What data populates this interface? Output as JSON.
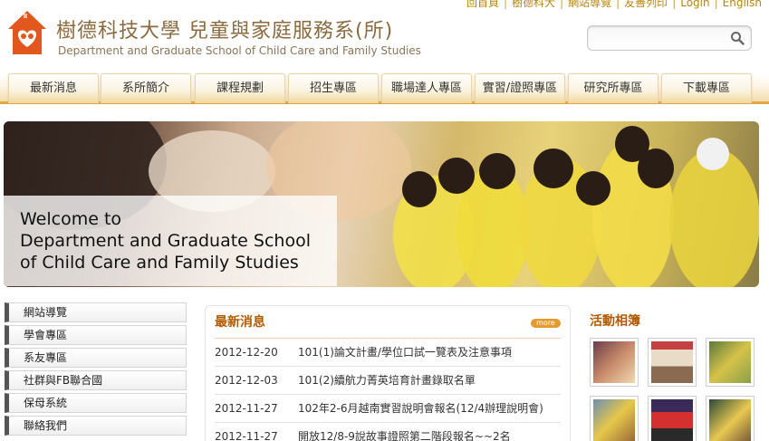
{
  "top_links": [
    "回首頁",
    "樹德科大",
    "網站導覽",
    "友善列印",
    "Login",
    "English"
  ],
  "header": {
    "title_zh": "樹德科技大學 兒童與家庭服務系(所)",
    "title_en": "Department and Graduate School of Child Care and Family Studies"
  },
  "search": {
    "placeholder": ""
  },
  "nav": [
    "最新消息",
    "系所簡介",
    "課程規劃",
    "招生專區",
    "職場達人專區",
    "實習/證照專區",
    "研究所專區",
    "下載專區"
  ],
  "banner": {
    "line1": "Welcome to",
    "line2": "Department and Graduate School",
    "line3": "of Child Care and Family Studies"
  },
  "left_menu": [
    "網站導覽",
    "學會專區",
    "系友專區",
    "社群與FB聯合國",
    "保母系統",
    "聯絡我們"
  ],
  "news": {
    "title": "最新消息",
    "more": "more",
    "items": [
      {
        "date": "2012-12-20",
        "text": "101(1)論文計畫/學位口試一覽表及注意事項"
      },
      {
        "date": "2012-12-03",
        "text": "101(2)續航力菁英培育計畫錄取名單"
      },
      {
        "date": "2012-11-27",
        "text": "102年2-6月越南實習說明會報名(12/4辦理說明會)"
      },
      {
        "date": "2012-11-27",
        "text": "開放12/8-9說故事證照第二階段報名~~2名"
      }
    ]
  },
  "album": {
    "title": "活動相簿"
  },
  "colors": {
    "accent": "#b25a00",
    "nav_border": "#e3a73f",
    "logo": "#e2571e"
  }
}
